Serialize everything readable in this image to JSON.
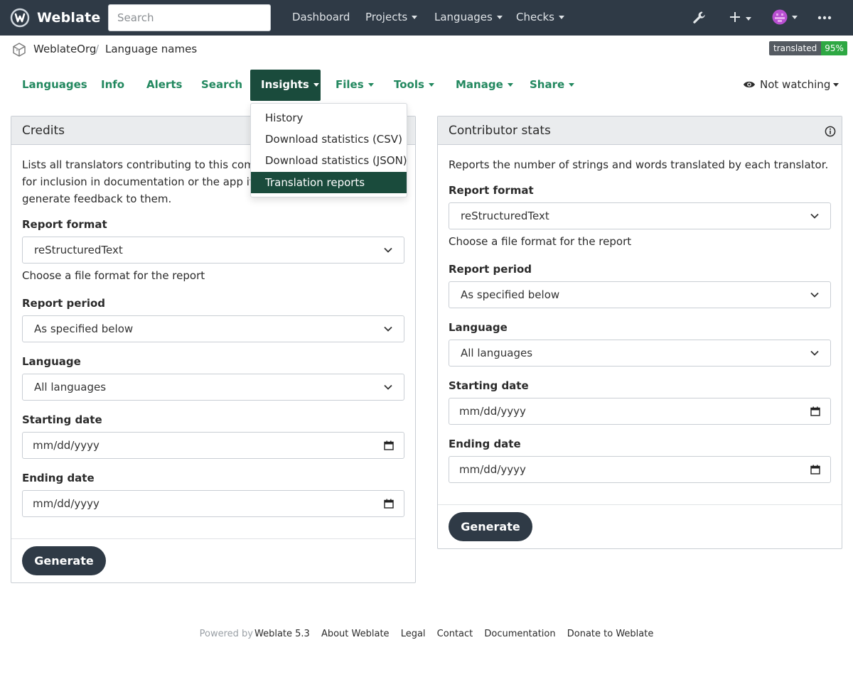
{
  "navbar": {
    "brand": "Weblate",
    "search_placeholder": "Search",
    "links": [
      "Dashboard",
      "Projects",
      "Languages",
      "Checks"
    ]
  },
  "breadcrumb": {
    "project": "WeblateOrg",
    "component": "Language names"
  },
  "status": {
    "label": "translated",
    "value": "95%"
  },
  "tabs": {
    "languages": "Languages",
    "info": "Info",
    "alerts": "Alerts",
    "search": "Search",
    "insights": "Insights",
    "files": "Files",
    "tools": "Tools",
    "manage": "Manage",
    "share": "Share",
    "watch": "Not watching"
  },
  "insights_menu": [
    "History",
    "Download statistics (CSV)",
    "Download statistics (JSON)",
    "Translation reports"
  ],
  "credits": {
    "title": "Credits",
    "description_1": "Lists all translators contributing to this compone",
    "description_2": "for inclusion in documentation or the app itself, t",
    "description_3": "generate feedback to them.",
    "format_label": "Report format",
    "format_value": "reStructuredText",
    "format_help": "Choose a file format for the report",
    "period_label": "Report period",
    "period_value": "As specified below",
    "language_label": "Language",
    "language_value": "All languages",
    "start_label": "Starting date",
    "start_placeholder": "mm/dd/yyyy",
    "end_label": "Ending date",
    "end_placeholder": "mm/dd/yyyy",
    "generate": "Generate"
  },
  "contributor": {
    "title": "Contributor stats",
    "description": "Reports the number of strings and words translated by each translator.",
    "format_label": "Report format",
    "format_value": "reStructuredText",
    "format_help": "Choose a file format for the report",
    "period_label": "Report period",
    "period_value": "As specified below",
    "language_label": "Language",
    "language_value": "All languages",
    "start_label": "Starting date",
    "start_placeholder": "mm/dd/yyyy",
    "end_label": "Ending date",
    "end_placeholder": "mm/dd/yyyy",
    "generate": "Generate"
  },
  "footer": {
    "powered_by": "Powered by",
    "version": "Weblate 5.3",
    "links": [
      "About Weblate",
      "Legal",
      "Contact",
      "Documentation",
      "Donate to Weblate"
    ]
  },
  "colors": {
    "navbar": "#2f3a46",
    "accent": "#1a4b3c",
    "tab_text": "#22885f",
    "badge_value": "#2ea843"
  }
}
